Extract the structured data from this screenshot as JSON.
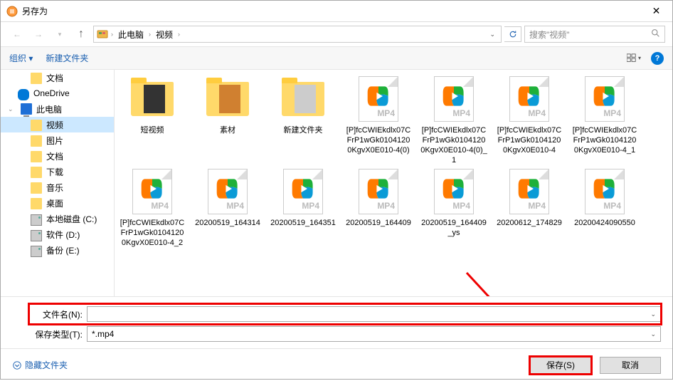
{
  "window": {
    "title": "另存为"
  },
  "nav": {
    "location_crumbs": [
      "此电脑",
      "视频"
    ],
    "search_placeholder": "搜索\"视频\""
  },
  "toolbar": {
    "organize": "组织 ▾",
    "new_folder": "新建文件夹"
  },
  "sidebar": {
    "items": [
      {
        "label": "文档",
        "icon": "folder",
        "indent": true
      },
      {
        "label": "OneDrive",
        "icon": "cloud",
        "indent": false
      },
      {
        "label": "此电脑",
        "icon": "monitor",
        "indent": false,
        "expandable": true
      },
      {
        "label": "视频",
        "icon": "folder",
        "indent": true,
        "selected": true
      },
      {
        "label": "图片",
        "icon": "folder",
        "indent": true
      },
      {
        "label": "文档",
        "icon": "folder",
        "indent": true
      },
      {
        "label": "下载",
        "icon": "folder",
        "indent": true
      },
      {
        "label": "音乐",
        "icon": "folder",
        "indent": true
      },
      {
        "label": "桌面",
        "icon": "folder",
        "indent": true
      },
      {
        "label": "本地磁盘 (C:)",
        "icon": "hdd",
        "indent": true
      },
      {
        "label": "软件 (D:)",
        "icon": "hdd",
        "indent": true
      },
      {
        "label": "备份 (E:)",
        "icon": "hdd",
        "indent": true
      }
    ]
  },
  "files": [
    {
      "name": "短视频",
      "type": "folder",
      "inner": "dark"
    },
    {
      "name": "素材",
      "type": "folder",
      "inner": "orange"
    },
    {
      "name": "新建文件夹",
      "type": "folder",
      "inner": "gray"
    },
    {
      "name": "[P]fcCWIEkdlx07CFrP1wGk01041200KgvX0E010-4(0)",
      "type": "mp4"
    },
    {
      "name": "[P]fcCWIEkdlx07CFrP1wGk01041200KgvX0E010-4(0)_1",
      "type": "mp4"
    },
    {
      "name": "[P]fcCWIEkdlx07CFrP1wGk01041200KgvX0E010-4",
      "type": "mp4"
    },
    {
      "name": "[P]fcCWIEkdlx07CFrP1wGk01041200KgvX0E010-4_1",
      "type": "mp4"
    },
    {
      "name": "[P]fcCWIEkdlx07CFrP1wGk01041200KgvX0E010-4_2",
      "type": "mp4"
    },
    {
      "name": "20200519_164314",
      "type": "mp4"
    },
    {
      "name": "20200519_164351",
      "type": "mp4"
    },
    {
      "name": "20200519_164409",
      "type": "mp4"
    },
    {
      "name": "20200519_164409_ys",
      "type": "mp4"
    },
    {
      "name": "20200612_174829",
      "type": "mp4"
    },
    {
      "name": "2020042409055​0",
      "type": "mp4"
    }
  ],
  "footer": {
    "filename_label": "文件名(N):",
    "filename_value": "",
    "filetype_label": "保存类型(T):",
    "filetype_value": "*.mp4",
    "hide_folders": "隐藏文件夹",
    "save_btn": "保存(S)",
    "cancel_btn": "取消"
  }
}
